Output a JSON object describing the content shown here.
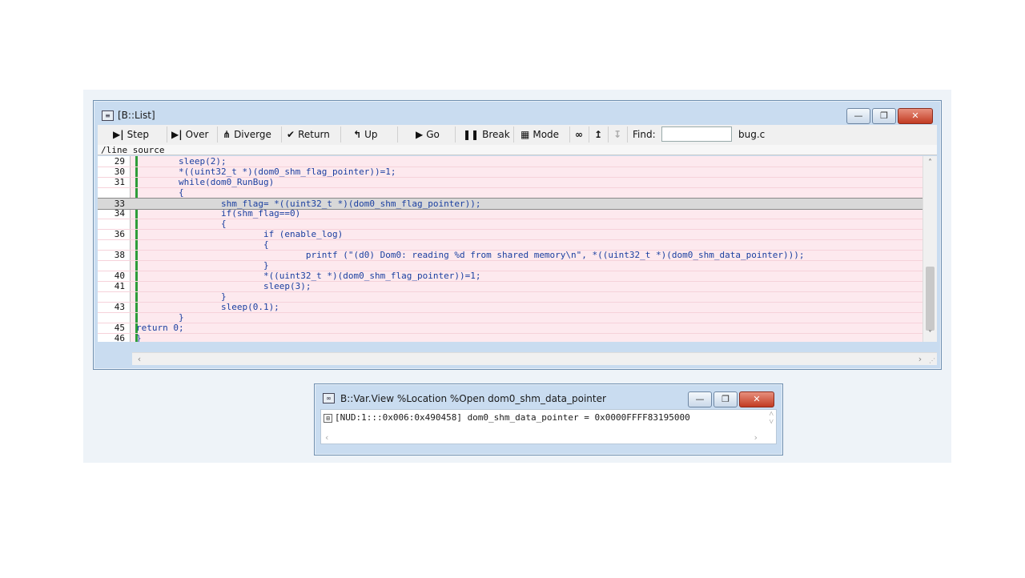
{
  "list_window": {
    "title": "[B::List]",
    "toolbar": [
      {
        "label": "Step",
        "icon": "step-icon",
        "glyph": "▶|"
      },
      {
        "label": "Over",
        "icon": "over-icon",
        "glyph": "▶|"
      },
      {
        "label": "Diverge",
        "icon": "diverge-icon",
        "glyph": "⋔"
      },
      {
        "label": "Return",
        "icon": "return-icon",
        "glyph": "✔"
      },
      {
        "label": "Up",
        "icon": "up-icon",
        "glyph": "↰"
      },
      {
        "label": "Go",
        "icon": "go-icon",
        "glyph": "▶"
      },
      {
        "label": "Break",
        "icon": "break-icon",
        "glyph": "❚❚"
      },
      {
        "label": "Mode",
        "icon": "mode-icon",
        "glyph": "▦"
      }
    ],
    "find_label": "Find:",
    "find_value": "",
    "file_name": "bug.c",
    "column_header": "/line source",
    "code_lines": [
      {
        "num": "29",
        "text": "        sleep(2);"
      },
      {
        "num": "30",
        "text": "        *((uint32_t *)(dom0_shm_flag_pointer))=1;"
      },
      {
        "num": "31",
        "text": "        while(dom0_RunBug)"
      },
      {
        "num": "",
        "text": "        {"
      },
      {
        "num": "33",
        "text": "                shm_flag= *((uint32_t *)(dom0_shm_flag_pointer));",
        "current": true
      },
      {
        "num": "34",
        "text": "                if(shm_flag==0)"
      },
      {
        "num": "",
        "text": "                {"
      },
      {
        "num": "36",
        "text": "                        if (enable_log)"
      },
      {
        "num": "",
        "text": "                        {"
      },
      {
        "num": "38",
        "text": "                                printf (\"(d0) Dom0: reading %d from shared memory\\n\", *((uint32_t *)(dom0_shm_data_pointer)));"
      },
      {
        "num": "",
        "text": "                        }"
      },
      {
        "num": "40",
        "text": "                        *((uint32_t *)(dom0_shm_flag_pointer))=1;"
      },
      {
        "num": "41",
        "text": "                        sleep(3);"
      },
      {
        "num": "",
        "text": "                }"
      },
      {
        "num": "43",
        "text": "                sleep(0.1);"
      },
      {
        "num": "",
        "text": "        }"
      },
      {
        "num": "45",
        "text": "return 0;"
      },
      {
        "num": "46",
        "text": "}"
      }
    ]
  },
  "var_window": {
    "title": "B::Var.View %Location %Open dom0_shm_data_pointer",
    "expander": "⊞",
    "row_text": "[NUD:1:::0x006:0x490458] dom0_shm_data_pointer = 0x0000FFFF83195000"
  },
  "controls": {
    "minimize": "—",
    "restore": "❐",
    "close": "✕"
  },
  "scroll": {
    "up": "˄",
    "down": "˅",
    "left": "‹",
    "right": "›"
  }
}
